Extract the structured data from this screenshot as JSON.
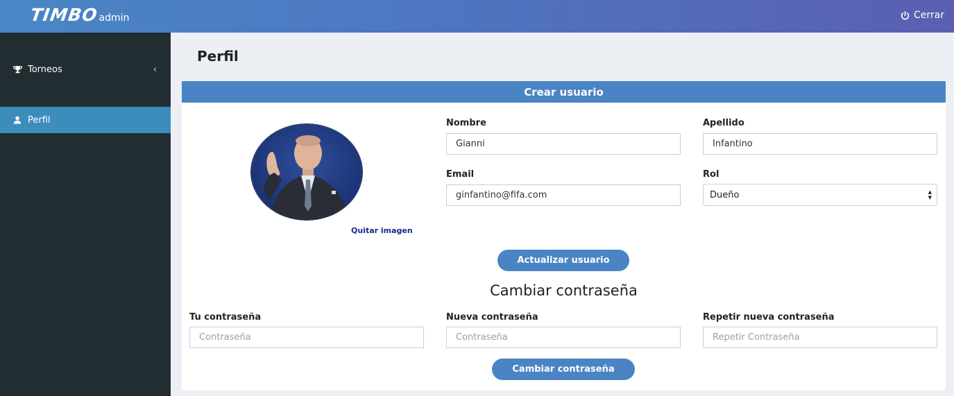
{
  "header": {
    "brand": "TIMBO",
    "brand_sub": "admin",
    "logout_label": "Cerrar",
    "logout_icon": "power-icon"
  },
  "sidebar": {
    "items": [
      {
        "label": "Torneos",
        "icon": "trophy-icon",
        "active": false
      },
      {
        "label": "Perfil",
        "icon": "user-icon",
        "active": true
      }
    ]
  },
  "page": {
    "title": "Perfil"
  },
  "card": {
    "header": "Crear usuario",
    "remove_image": "Quitar imagen",
    "name_label": "Nombre",
    "name_value": "Gianni",
    "surname_label": "Apellido",
    "surname_value": "Infantino",
    "email_label": "Email",
    "email_value": "ginfantino@fifa.com",
    "role_label": "Rol",
    "role_value": "Dueño",
    "update_button": "Actualizar usuario",
    "password_section": "Cambiar contraseña",
    "current_password_label": "Tu contraseña",
    "current_password_placeholder": "Contraseña",
    "new_password_label": "Nueva contraseña",
    "new_password_placeholder": "Contraseña",
    "repeat_password_label": "Repetir nueva contraseña",
    "repeat_password_placeholder": "Repetir Contraseña",
    "change_password_button": "Cambiar contraseña"
  },
  "colors": {
    "header_start": "#4a86c5",
    "header_end": "#5a5fb0",
    "sidebar": "#222d32",
    "sidebar_active": "#3c8dbc",
    "accent": "#4a84c4",
    "background": "#ecf0f5"
  }
}
